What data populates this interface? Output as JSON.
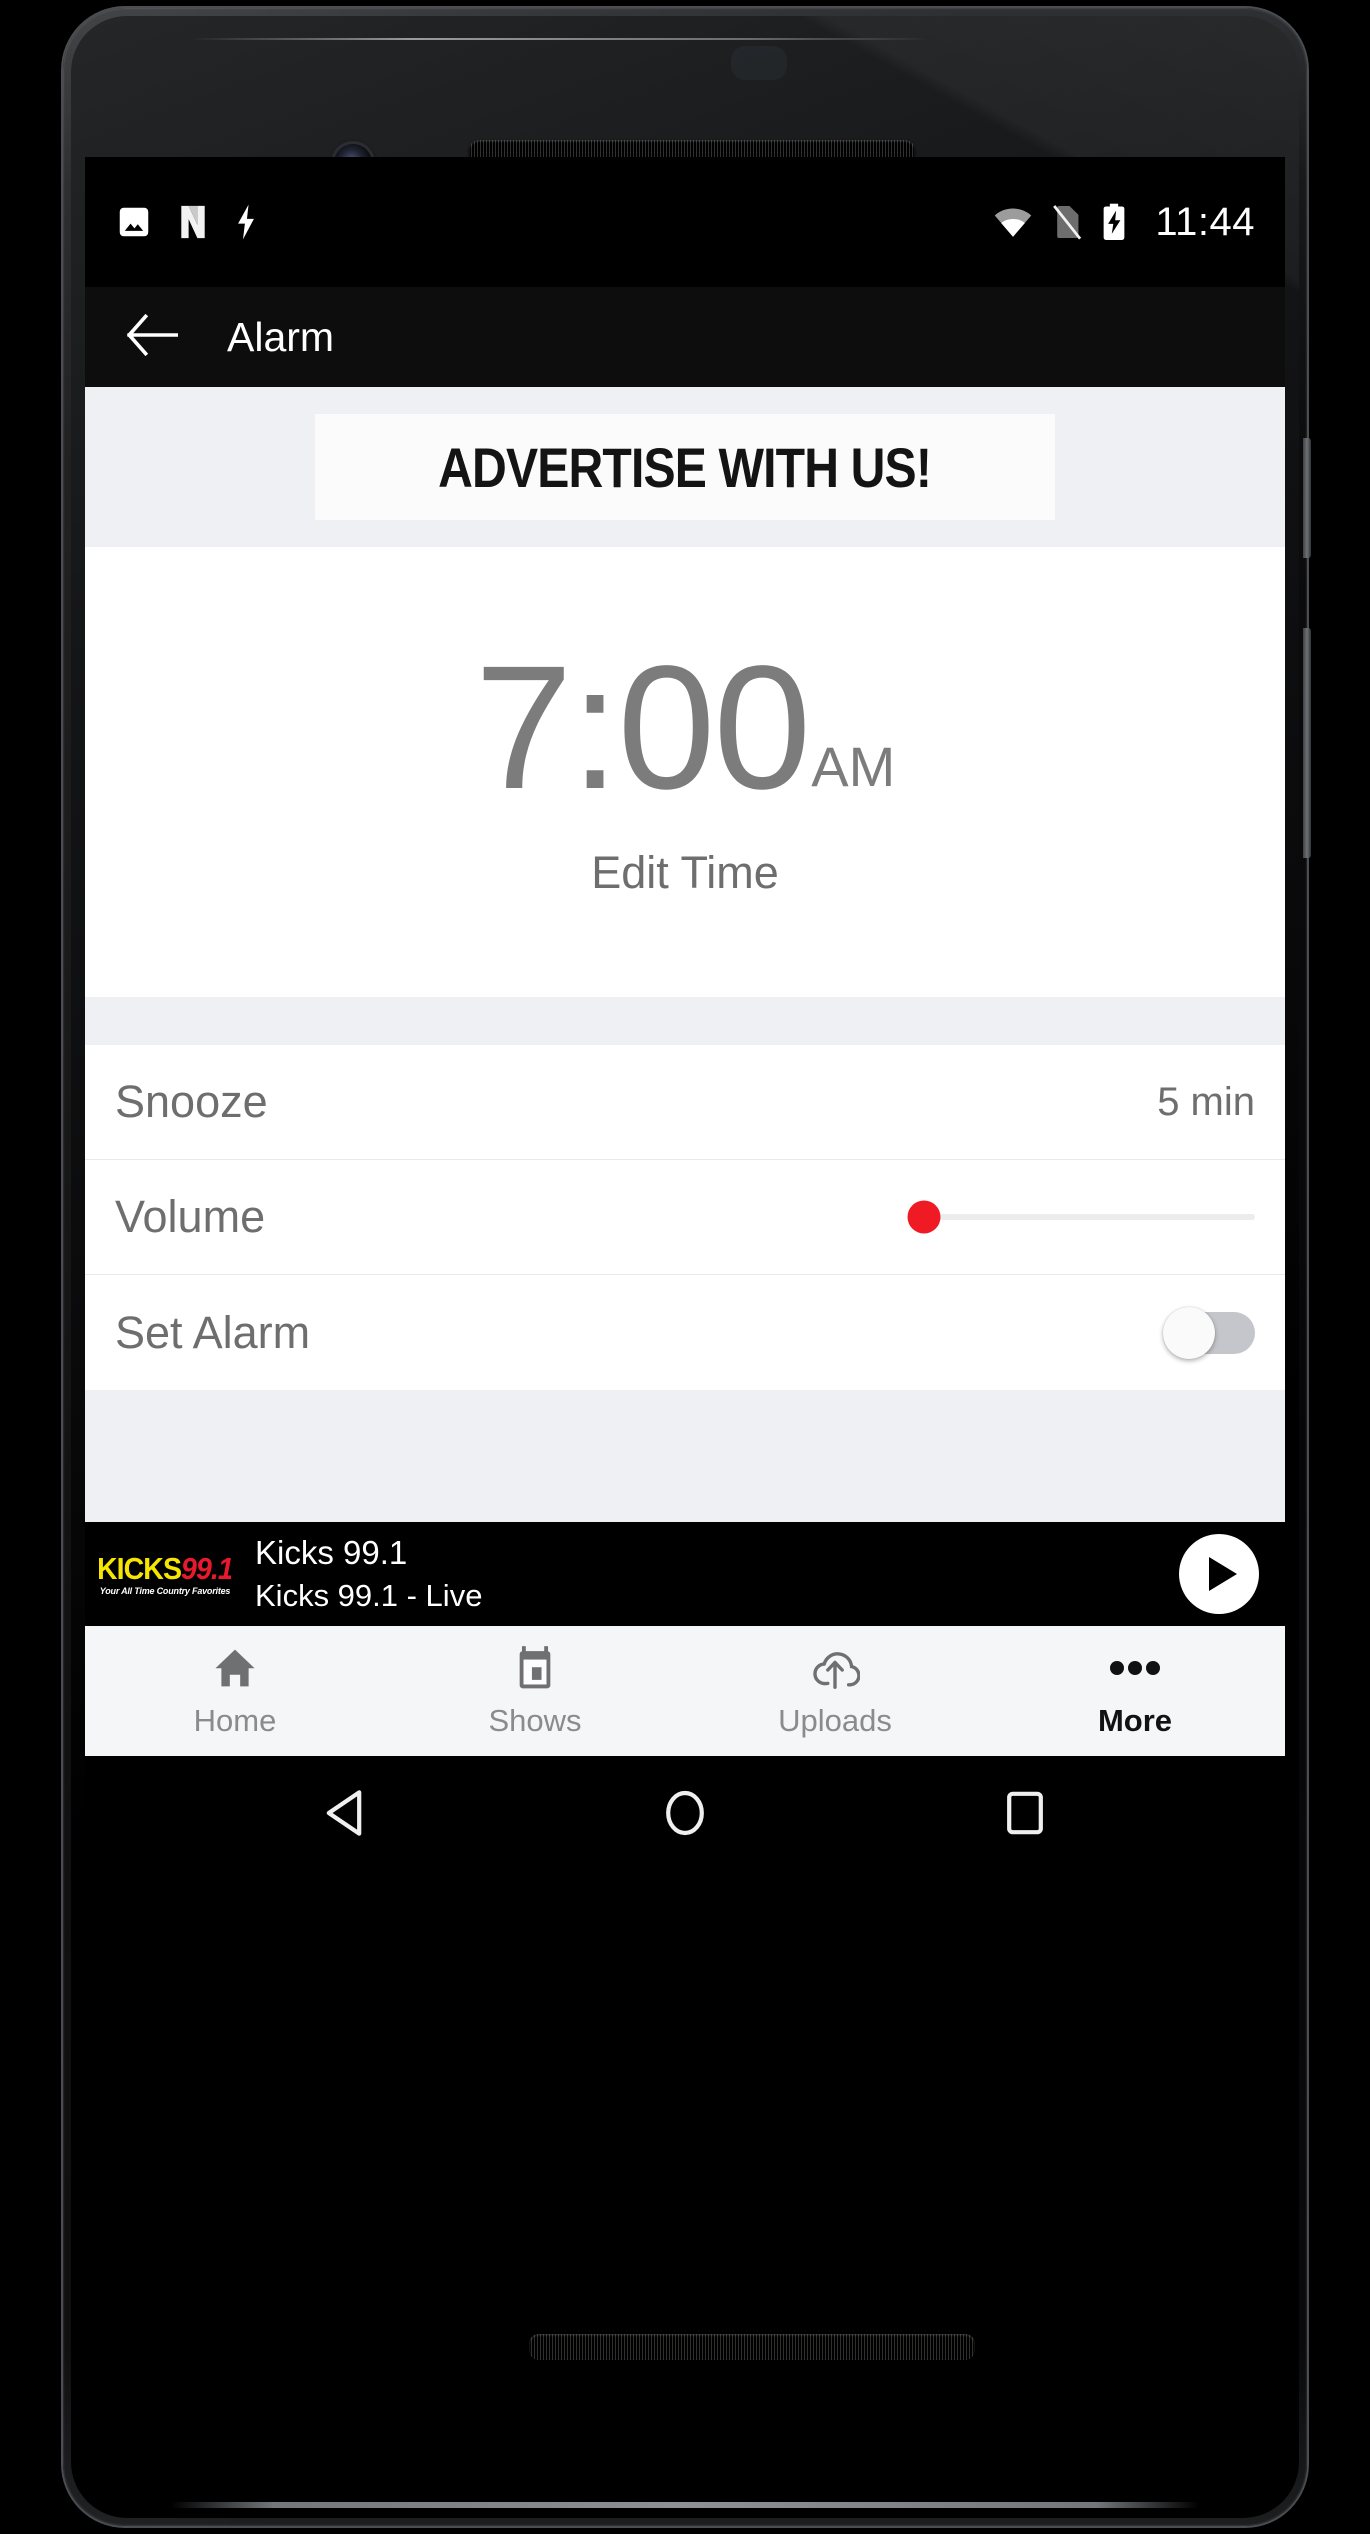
{
  "device": {
    "frame": "android-phone-mockup",
    "hardware": {
      "front_camera": "front-camera",
      "earpiece": "earpiece-speaker",
      "bottom_speaker": "bottom-speaker"
    }
  },
  "status_bar": {
    "clock": "11:44",
    "left_icons": [
      "image-icon",
      "netflix-n-icon",
      "lightning-bolt-icon"
    ],
    "right_icons": [
      "wifi-icon",
      "no-sim-icon",
      "battery-charging-icon"
    ]
  },
  "app_bar": {
    "back_icon": "back-arrow-icon",
    "title": "Alarm"
  },
  "ad_banner": {
    "text": "ADVERTISE WITH US!"
  },
  "alarm": {
    "time": "7:00",
    "meridiem": "AM",
    "edit_label": "Edit Time"
  },
  "settings": {
    "rows": [
      {
        "label": "Snooze",
        "value": "5 min",
        "type": "value"
      },
      {
        "label": "Volume",
        "value": "",
        "type": "slider"
      },
      {
        "label": "Set Alarm",
        "value": "",
        "type": "toggle"
      }
    ],
    "volume": {
      "percent": 4,
      "accent": "#ef1a23"
    },
    "set_alarm": {
      "enabled": false
    }
  },
  "player": {
    "logo": {
      "word": "KICKS",
      "freq": "99.1",
      "tagline": "Your All Time Country Favorites",
      "word_color": "#f5e500",
      "freq_color": "#e8192c"
    },
    "title": "Kicks 99.1",
    "subtitle": "Kicks 99.1 - Live",
    "play_icon": "play-icon"
  },
  "tab_bar": {
    "tabs": [
      {
        "label": "Home",
        "icon": "home-icon",
        "active": false
      },
      {
        "label": "Shows",
        "icon": "calendar-icon",
        "active": false
      },
      {
        "label": "Uploads",
        "icon": "cloud-upload-icon",
        "active": false
      },
      {
        "label": "More",
        "icon": "more-dots-icon",
        "active": true
      }
    ]
  },
  "nav_bar": {
    "buttons": [
      "back-triangle-icon",
      "home-circle-icon",
      "recents-square-icon"
    ]
  }
}
